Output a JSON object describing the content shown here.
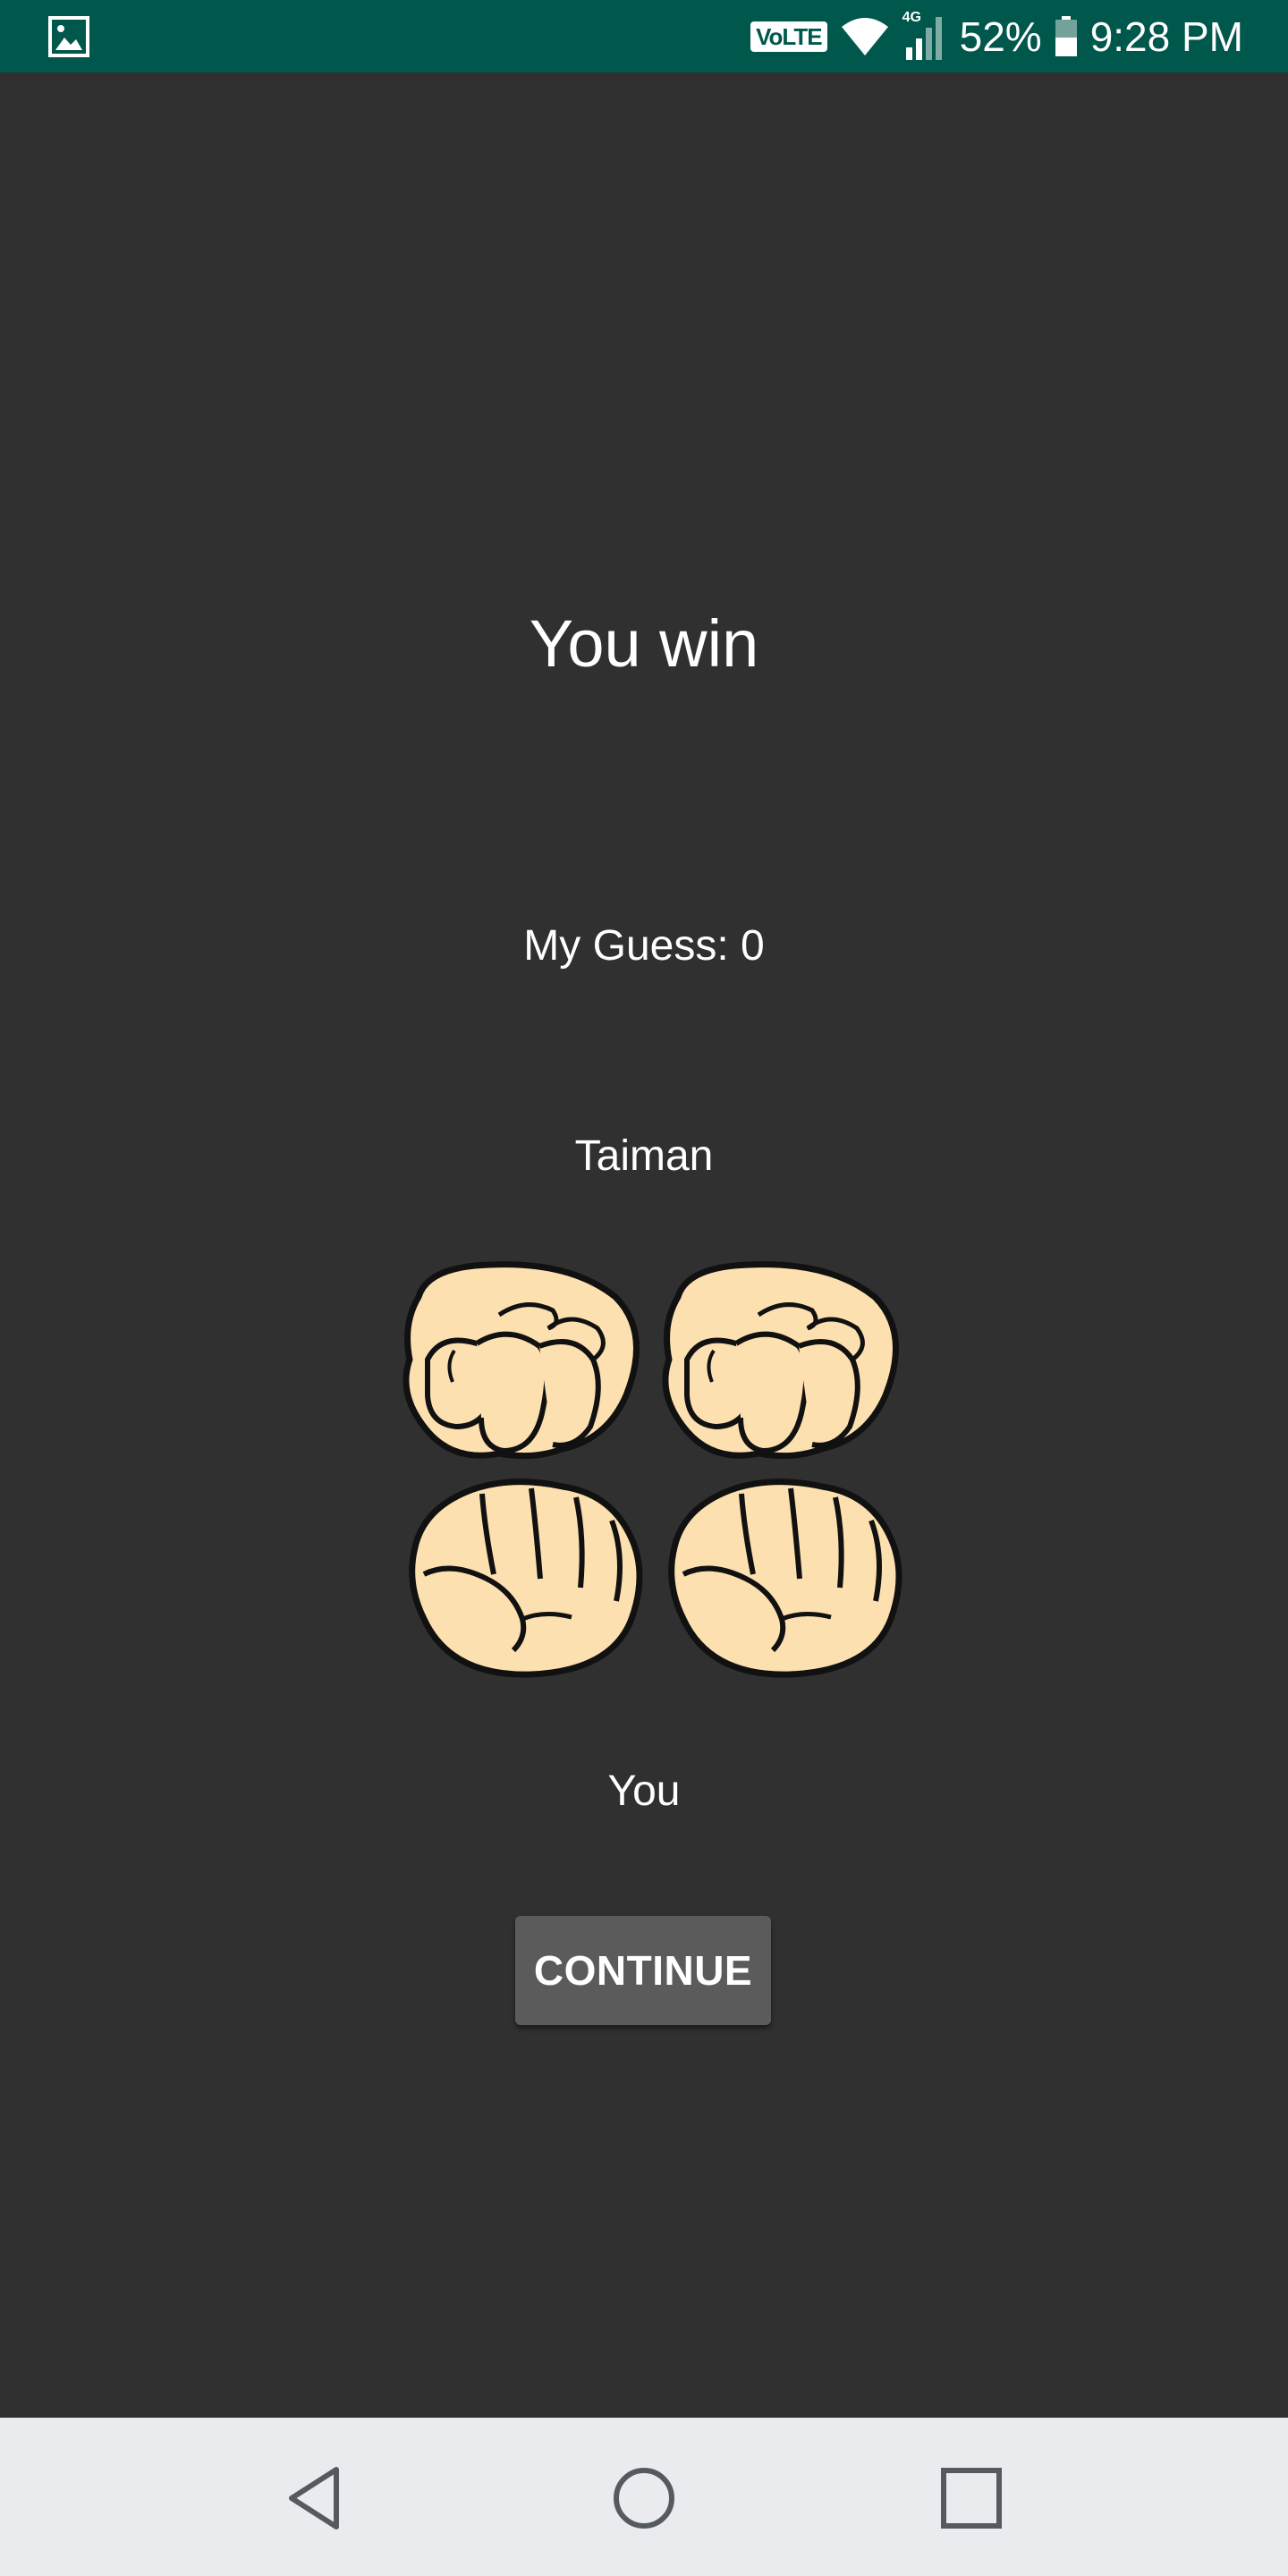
{
  "status_bar": {
    "network_label": "VoLTE",
    "signal_label": "4G",
    "battery_percent": "52%",
    "time": "9:28 PM",
    "icons": [
      "image-notification-icon",
      "wifi-icon",
      "cell-signal-icon",
      "battery-icon"
    ]
  },
  "game": {
    "result_title": "You win",
    "guess_text": "My Guess: 0",
    "opponent_name": "Taiman",
    "player_name": "You",
    "continue_label": "CONTINUE"
  },
  "hands": {
    "opponent": [
      "closed-fist",
      "closed-fist"
    ],
    "player": [
      "closed-fist",
      "closed-fist"
    ]
  },
  "nav_bar": {
    "icons": [
      "back-icon",
      "home-icon",
      "recent-apps-icon"
    ]
  },
  "colors": {
    "status_bar": "#00574b",
    "background": "#303030",
    "button": "#5b5b5b",
    "nav_bar": "#e9ebee",
    "skin": "#fde0b0"
  }
}
